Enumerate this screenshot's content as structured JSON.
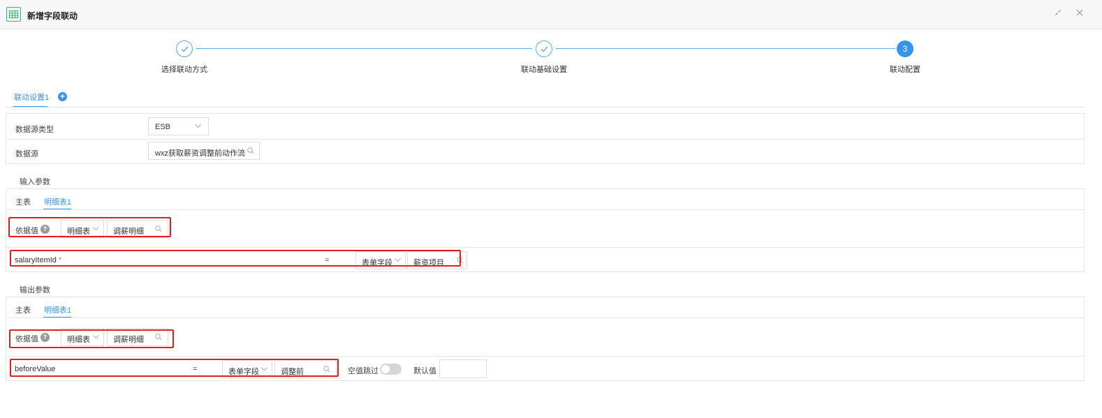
{
  "window": {
    "title": "新增字段联动"
  },
  "stepper": {
    "steps": [
      {
        "label": "选择联动方式",
        "state": "done"
      },
      {
        "label": "联动基础设置",
        "state": "done"
      },
      {
        "label": "联动配置",
        "state": "active",
        "number": "3"
      }
    ]
  },
  "config_tab": {
    "label": "联动设置1",
    "add_symbol": "+"
  },
  "datasource": {
    "type_label": "数据源类型",
    "type_value": "ESB",
    "source_label": "数据源",
    "source_value": "wxz获取薪资调整前动作流"
  },
  "input_params": {
    "title": "输入参数",
    "tabs": [
      "主表",
      "明细表1"
    ],
    "active_tab": "明细表1",
    "basis_label": "依据值",
    "basis_type": "明细表",
    "basis_value": "调薪明细",
    "row": {
      "field": "salaryItemId",
      "required_mark": "*",
      "operator": "=",
      "source_type": "表单字段",
      "source_value": "薪资项目"
    }
  },
  "output_params": {
    "title": "输出参数",
    "tabs": [
      "主表",
      "明细表1"
    ],
    "active_tab": "明细表1",
    "basis_label": "依据值",
    "basis_type": "明细表",
    "basis_value": "调薪明细",
    "row": {
      "field": "beforeValue",
      "operator": "=",
      "target_type": "表单字段",
      "target_value": "调整前",
      "skip_empty_label": "空值跳过",
      "skip_empty_on": false,
      "default_label": "默认值",
      "default_value": ""
    }
  },
  "colors": {
    "accent": "#3594f0",
    "highlight": "#e02020",
    "title_icon": "#3cba7a"
  }
}
